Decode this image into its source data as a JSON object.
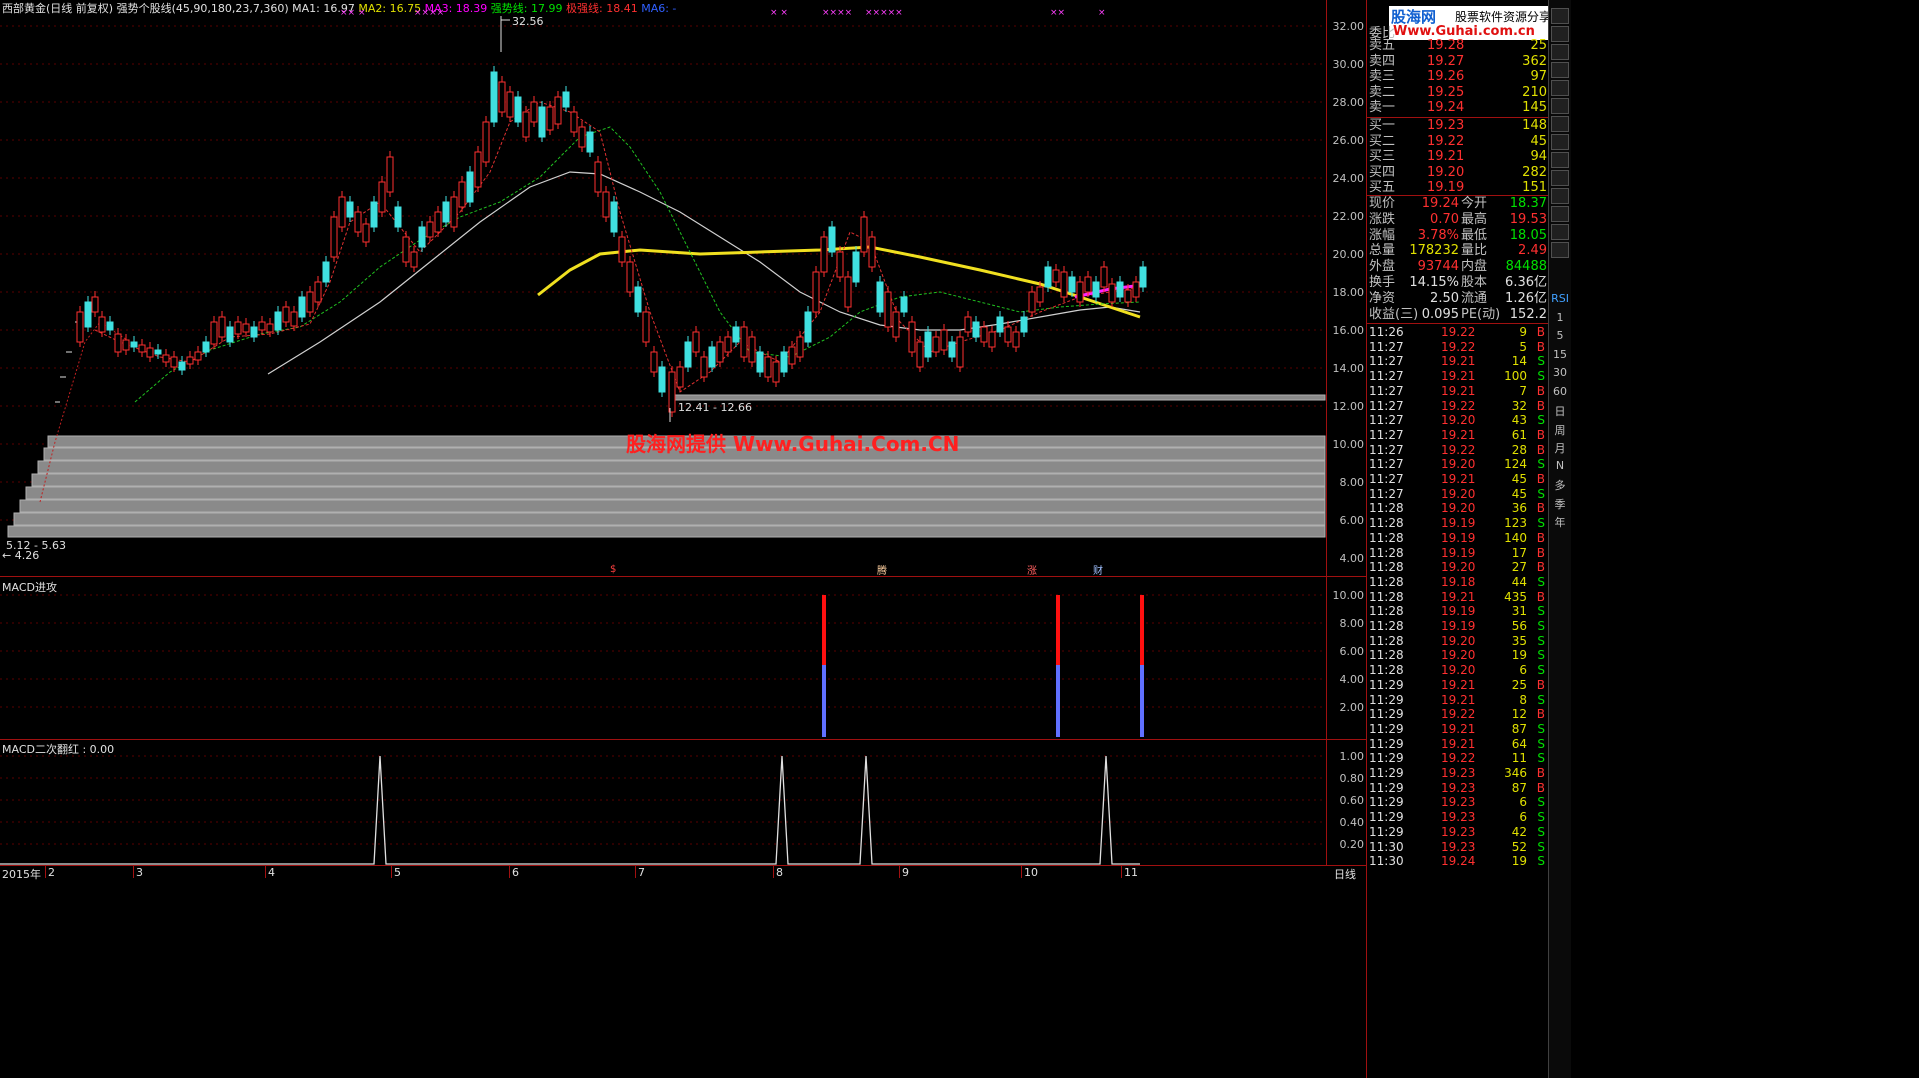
{
  "header": {
    "stock": "西部黄金(日线 前复权)",
    "indicator": "强势个股线(45,90,180,23,7,360)",
    "ma1": "MA1: 16.97",
    "ma2": "MA2: 16.75",
    "ma3": "MA3: 18.39",
    "strong": "强势线: 17.99",
    "weak": "极强线: 18.41",
    "ma6": "MA6: -"
  },
  "price_axis": [
    "32.00",
    "30.00",
    "28.00",
    "26.00",
    "24.00",
    "22.00",
    "20.00",
    "18.00",
    "16.00",
    "14.00",
    "12.00",
    "10.00",
    "8.00",
    "6.00",
    "4.00"
  ],
  "annotations": {
    "high": "32.56",
    "range_low": "12.41 - 12.66",
    "range_bottom": "5.12 - 5.63",
    "low": "← 4.26",
    "watermark": "股海网提供 Www.Guhai.Com.CN",
    "event1": "$",
    "event2": "腾",
    "event3": "涨",
    "event4": "财"
  },
  "macd_panel": {
    "title": "MACD进攻",
    "axis": [
      "10.00",
      "8.00",
      "6.00",
      "4.00",
      "2.00"
    ]
  },
  "macd2_panel": {
    "title": "MACD二次翻红 : 0.00",
    "axis": [
      "1.00",
      "0.80",
      "0.60",
      "0.40",
      "0.20"
    ]
  },
  "time_axis": {
    "year": "2015年",
    "months": [
      "2",
      "3",
      "4",
      "5",
      "6",
      "7",
      "8",
      "9",
      "10",
      "11"
    ],
    "period": "日线"
  },
  "logo": {
    "brand": "股海网",
    "slogan": "股票软件资源分享",
    "url": "Www.Guhai.com.cn"
  },
  "orderbook": {
    "weibi_label": "委比",
    "asks": [
      {
        "label": "卖五",
        "price": "19.28",
        "vol": "25"
      },
      {
        "label": "卖四",
        "price": "19.27",
        "vol": "362"
      },
      {
        "label": "卖三",
        "price": "19.26",
        "vol": "97"
      },
      {
        "label": "卖二",
        "price": "19.25",
        "vol": "210"
      },
      {
        "label": "卖一",
        "price": "19.24",
        "vol": "145"
      }
    ],
    "bids": [
      {
        "label": "买一",
        "price": "19.23",
        "vol": "148"
      },
      {
        "label": "买二",
        "price": "19.22",
        "vol": "45"
      },
      {
        "label": "买三",
        "price": "19.21",
        "vol": "94"
      },
      {
        "label": "买四",
        "price": "19.20",
        "vol": "282"
      },
      {
        "label": "买五",
        "price": "19.19",
        "vol": "151"
      }
    ]
  },
  "stats": [
    {
      "l1": "现价",
      "v1": "19.24",
      "l2": "今开",
      "v2": "18.37",
      "c1": "#ff3030",
      "c2": "#00e000"
    },
    {
      "l1": "涨跌",
      "v1": "0.70",
      "l2": "最高",
      "v2": "19.53",
      "c1": "#ff3030",
      "c2": "#ff3030"
    },
    {
      "l1": "涨幅",
      "v1": "3.78%",
      "l2": "最低",
      "v2": "18.05",
      "c1": "#ff3030",
      "c2": "#00e000"
    },
    {
      "l1": "总量",
      "v1": "178232",
      "l2": "量比",
      "v2": "2.49",
      "c1": "#e0e000",
      "c2": "#ff3030"
    },
    {
      "l1": "外盘",
      "v1": "93744",
      "l2": "内盘",
      "v2": "84488",
      "c1": "#ff3030",
      "c2": "#00e000"
    },
    {
      "l1": "换手",
      "v1": "14.15%",
      "l2": "股本",
      "v2": "6.36亿",
      "c1": "#e0e0e0",
      "c2": "#e0e0e0"
    },
    {
      "l1": "净资",
      "v1": "2.50",
      "l2": "流通",
      "v2": "1.26亿",
      "c1": "#e0e0e0",
      "c2": "#e0e0e0"
    },
    {
      "l1": "收益(三)",
      "v1": "0.095",
      "l2": "PE(动)",
      "v2": "152.2",
      "c1": "#e0e0e0",
      "c2": "#e0e0e0"
    }
  ],
  "ticks": [
    [
      "11:26",
      "19.22",
      "9",
      "B"
    ],
    [
      "11:27",
      "19.22",
      "5",
      "B"
    ],
    [
      "11:27",
      "19.21",
      "14",
      "S"
    ],
    [
      "11:27",
      "19.21",
      "100",
      "S"
    ],
    [
      "11:27",
      "19.21",
      "7",
      "B"
    ],
    [
      "11:27",
      "19.22",
      "32",
      "B"
    ],
    [
      "11:27",
      "19.20",
      "43",
      "S"
    ],
    [
      "11:27",
      "19.21",
      "61",
      "B"
    ],
    [
      "11:27",
      "19.22",
      "28",
      "B"
    ],
    [
      "11:27",
      "19.20",
      "124",
      "S"
    ],
    [
      "11:27",
      "19.21",
      "45",
      "B"
    ],
    [
      "11:27",
      "19.20",
      "45",
      "S"
    ],
    [
      "11:28",
      "19.20",
      "36",
      "B"
    ],
    [
      "11:28",
      "19.19",
      "123",
      "S"
    ],
    [
      "11:28",
      "19.19",
      "140",
      "B"
    ],
    [
      "11:28",
      "19.19",
      "17",
      "B"
    ],
    [
      "11:28",
      "19.20",
      "27",
      "B"
    ],
    [
      "11:28",
      "19.18",
      "44",
      "S"
    ],
    [
      "11:28",
      "19.21",
      "435",
      "B"
    ],
    [
      "11:28",
      "19.19",
      "31",
      "S"
    ],
    [
      "11:28",
      "19.19",
      "56",
      "S"
    ],
    [
      "11:28",
      "19.20",
      "35",
      "S"
    ],
    [
      "11:28",
      "19.20",
      "19",
      "S"
    ],
    [
      "11:28",
      "19.20",
      "6",
      "S"
    ],
    [
      "11:29",
      "19.21",
      "25",
      "B"
    ],
    [
      "11:29",
      "19.21",
      "8",
      "S"
    ],
    [
      "11:29",
      "19.22",
      "12",
      "B"
    ],
    [
      "11:29",
      "19.21",
      "87",
      "S"
    ],
    [
      "11:29",
      "19.21",
      "64",
      "S"
    ],
    [
      "11:29",
      "19.22",
      "11",
      "S"
    ],
    [
      "11:29",
      "19.23",
      "346",
      "B"
    ],
    [
      "11:29",
      "19.23",
      "87",
      "B"
    ],
    [
      "11:29",
      "19.23",
      "6",
      "S"
    ],
    [
      "11:29",
      "19.23",
      "6",
      "S"
    ],
    [
      "11:29",
      "19.23",
      "42",
      "S"
    ],
    [
      "11:30",
      "19.23",
      "52",
      "S"
    ],
    [
      "11:30",
      "19.24",
      "19",
      "S"
    ]
  ],
  "toolbar": [
    "RSI",
    "1",
    "5",
    "15",
    "30",
    "60",
    "日",
    "周",
    "月",
    "N",
    "多",
    "季",
    "年"
  ],
  "chart_data": {
    "type": "candlestick",
    "ylim": [
      4,
      33
    ],
    "high_label": 32.56,
    "macd_signals": [
      {
        "month": "8",
        "value": 10
      },
      {
        "month": "10",
        "value": 10
      },
      {
        "month": "11",
        "value": 10
      }
    ],
    "macd2_spikes": [
      1,
      1,
      1,
      1
    ]
  }
}
